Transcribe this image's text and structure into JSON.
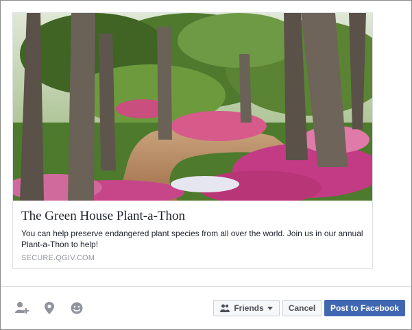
{
  "link_preview": {
    "image_alt": "Garden path lined with oak trees and pink azaleas",
    "title": "The Green House Plant-a-Thon",
    "description": "You can help preserve endangered plant species from all over the world. Join us in our annual Plant-a-Thon to help!",
    "domain": "SECURE.QGIV.COM"
  },
  "footer": {
    "icons": [
      "tag-friends-icon",
      "location-pin-icon",
      "feeling-smiley-icon"
    ],
    "audience_label": "Friends",
    "cancel_label": "Cancel",
    "post_label": "Post to Facebook"
  },
  "colors": {
    "post_button": "#4267b2",
    "secondary_button_bg": "#f6f7f9",
    "domain_text": "#90949c",
    "border": "#dddfe2"
  }
}
